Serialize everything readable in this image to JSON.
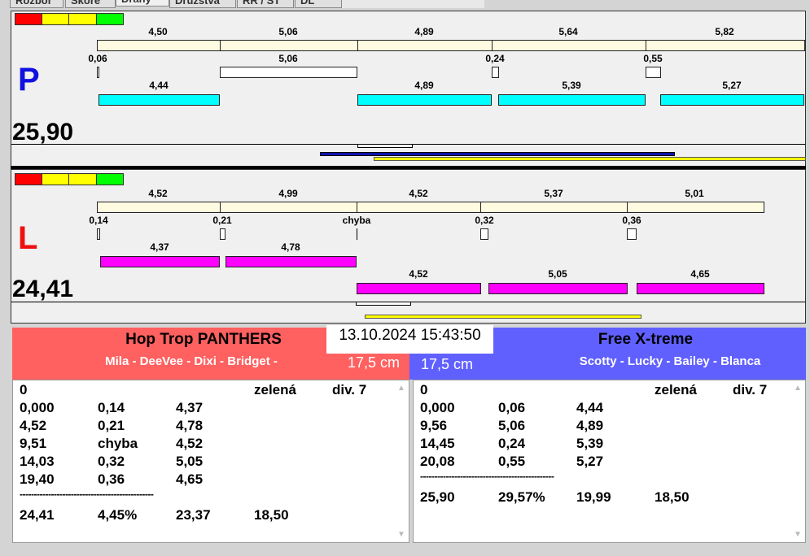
{
  "tabs": [
    "Rozbor",
    "Skóre",
    "Dráhy",
    "Družstva",
    "RR / ST",
    "DL"
  ],
  "lanes": {
    "P": {
      "letter": "P",
      "color": "#1010e0",
      "total": "25,90",
      "top": [
        "4,50",
        "5,06",
        "4,89",
        "5,64",
        "5,82"
      ],
      "mid": [
        "0,06",
        "5,06",
        "0,24",
        "0,55"
      ],
      "bottom": [
        "4,44",
        "4,89",
        "5,39",
        "5,27"
      ]
    },
    "L": {
      "letter": "L",
      "color": "#ee1010",
      "total": "24,41",
      "top": [
        "4,52",
        "4,99",
        "4,52",
        "5,37",
        "5,01"
      ],
      "mid": [
        "0,14",
        "0,21",
        "chyba",
        "0,32",
        "0,36"
      ],
      "bottom1": [
        "4,37",
        "4,78"
      ],
      "bottom2": [
        "4,52",
        "5,05",
        "4,65"
      ]
    }
  },
  "datetime": "13.10.2024 15:43:50",
  "left_team": {
    "name": "Hop Trop PANTHERS",
    "dogs": "Mila - DeeVee - Dixi - Bridget -",
    "height": "17,5 cm",
    "color": "#ff6060",
    "header": [
      "0",
      "zelená",
      "div. 7"
    ],
    "rows": [
      [
        "0,000",
        "0,14",
        "4,37"
      ],
      [
        "4,52",
        "0,21",
        "4,78"
      ],
      [
        "9,51",
        "chyba",
        "4,52"
      ],
      [
        "14,03",
        "0,32",
        "5,05"
      ],
      [
        "19,40",
        "0,36",
        "4,65"
      ]
    ],
    "separator": "-----------------------------------------------",
    "totals": [
      "24,41",
      "4,45%",
      "23,37",
      "18,50"
    ]
  },
  "right_team": {
    "name": "Free X-treme",
    "dogs": "Scotty - Lucky - Bailey - Blanca",
    "height": "17,5 cm",
    "color": "#6060ff",
    "header": [
      "0",
      "zelená",
      "div. 7"
    ],
    "rows": [
      [
        "0,000",
        "0,06",
        "4,44"
      ],
      [
        "9,56",
        "5,06",
        "4,89"
      ],
      [
        "14,45",
        "0,24",
        "5,39"
      ],
      [
        "20,08",
        "0,55",
        "5,27"
      ]
    ],
    "separator": "-----------------------------------------------",
    "totals": [
      "25,90",
      "29,57%",
      "19,99",
      "18,50"
    ]
  }
}
